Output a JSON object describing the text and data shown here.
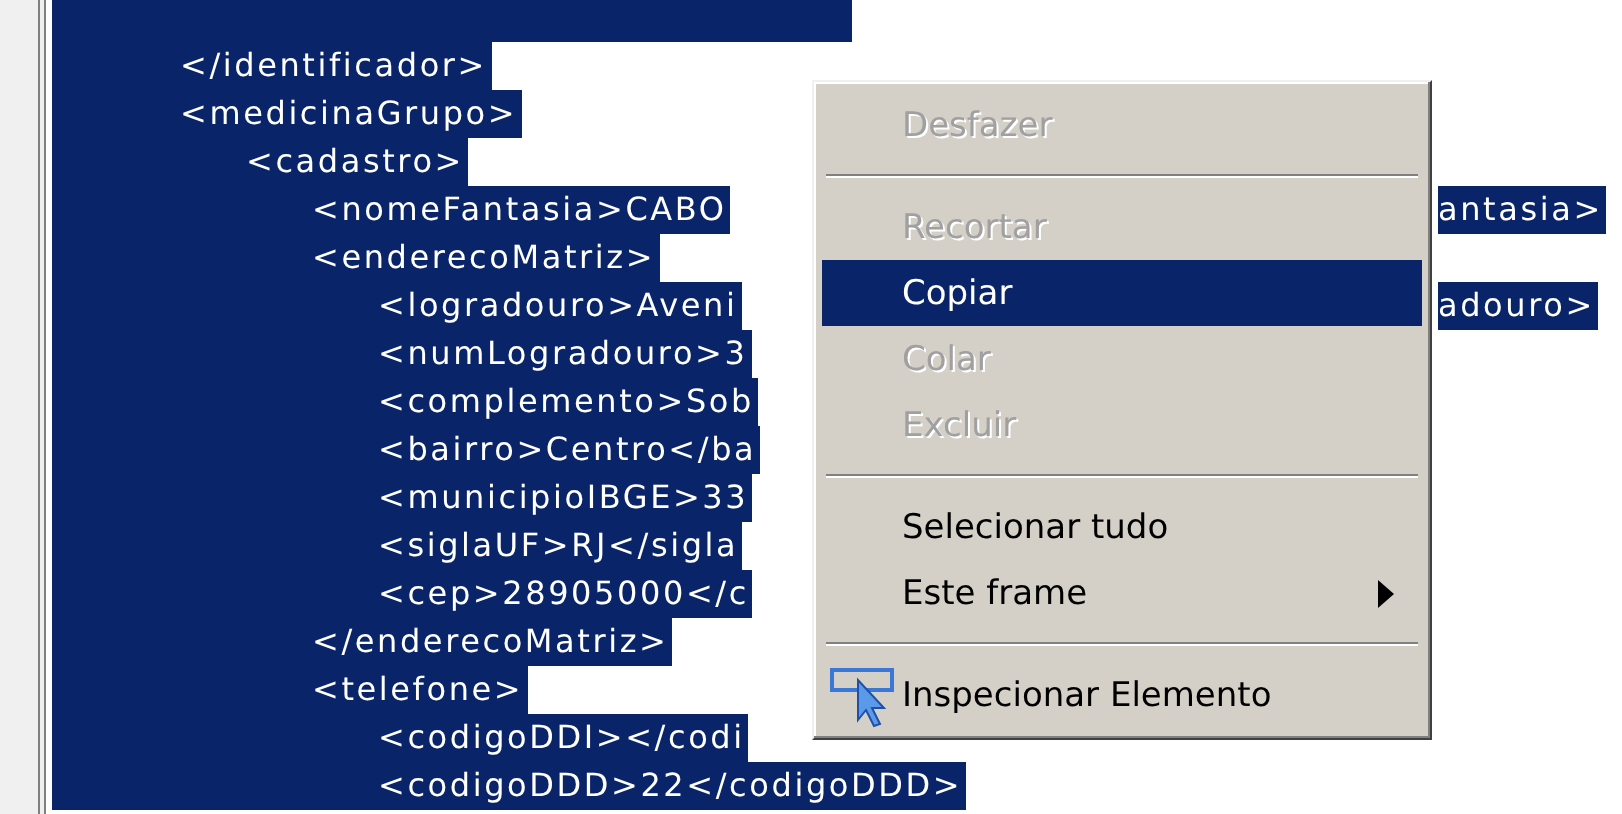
{
  "tree": [
    {
      "text": "</identificador>",
      "selected": true
    },
    {
      "text": "<medicinaGrupo>",
      "selected": true,
      "children": [
        {
          "text": "<cadastro>",
          "selected": true,
          "children": [
            {
              "text": "<nomeFantasia>CABO",
              "selected": true,
              "after": "antasia>"
            },
            {
              "text": "<enderecoMatriz>",
              "selected": true,
              "children": [
                {
                  "text": "<logradouro>Aveni",
                  "selected": true,
                  "after": "adouro>"
                },
                {
                  "text": "<numLogradouro>3",
                  "selected": true
                },
                {
                  "text": "<complemento>Sob",
                  "selected": true
                },
                {
                  "text": "<bairro>Centro</ba",
                  "selected": true
                },
                {
                  "text": "<municipioIBGE>33",
                  "selected": true
                },
                {
                  "text": "<siglaUF>RJ</sigla",
                  "selected": true
                },
                {
                  "text": "<cep>28905000</c",
                  "selected": true
                }
              ]
            },
            {
              "text": "</enderecoMatriz>",
              "selected": true
            },
            {
              "text": "<telefone>",
              "selected": true,
              "children": [
                {
                  "text": "<codigoDDI></codi",
                  "selected": true
                },
                {
                  "text": "<codigoDDD>22</codigoDDD>",
                  "selected": true
                }
              ]
            }
          ]
        }
      ]
    }
  ],
  "context_menu": {
    "items": [
      {
        "kind": "item",
        "label": "Desfazer",
        "disabled": true,
        "selected": false
      },
      {
        "kind": "separator"
      },
      {
        "kind": "item",
        "label": "Recortar",
        "disabled": true,
        "selected": false
      },
      {
        "kind": "item",
        "label": "Copiar",
        "disabled": false,
        "selected": true
      },
      {
        "kind": "item",
        "label": "Colar",
        "disabled": true,
        "selected": false
      },
      {
        "kind": "item",
        "label": "Excluir",
        "disabled": true,
        "selected": false
      },
      {
        "kind": "separator"
      },
      {
        "kind": "item",
        "label": "Selecionar tudo",
        "disabled": false,
        "selected": false
      },
      {
        "kind": "submenu",
        "label": "Este frame",
        "disabled": false,
        "selected": false
      },
      {
        "kind": "separator"
      },
      {
        "kind": "inspect",
        "label": "Inspecionar Elemento",
        "disabled": false,
        "selected": false
      }
    ]
  }
}
